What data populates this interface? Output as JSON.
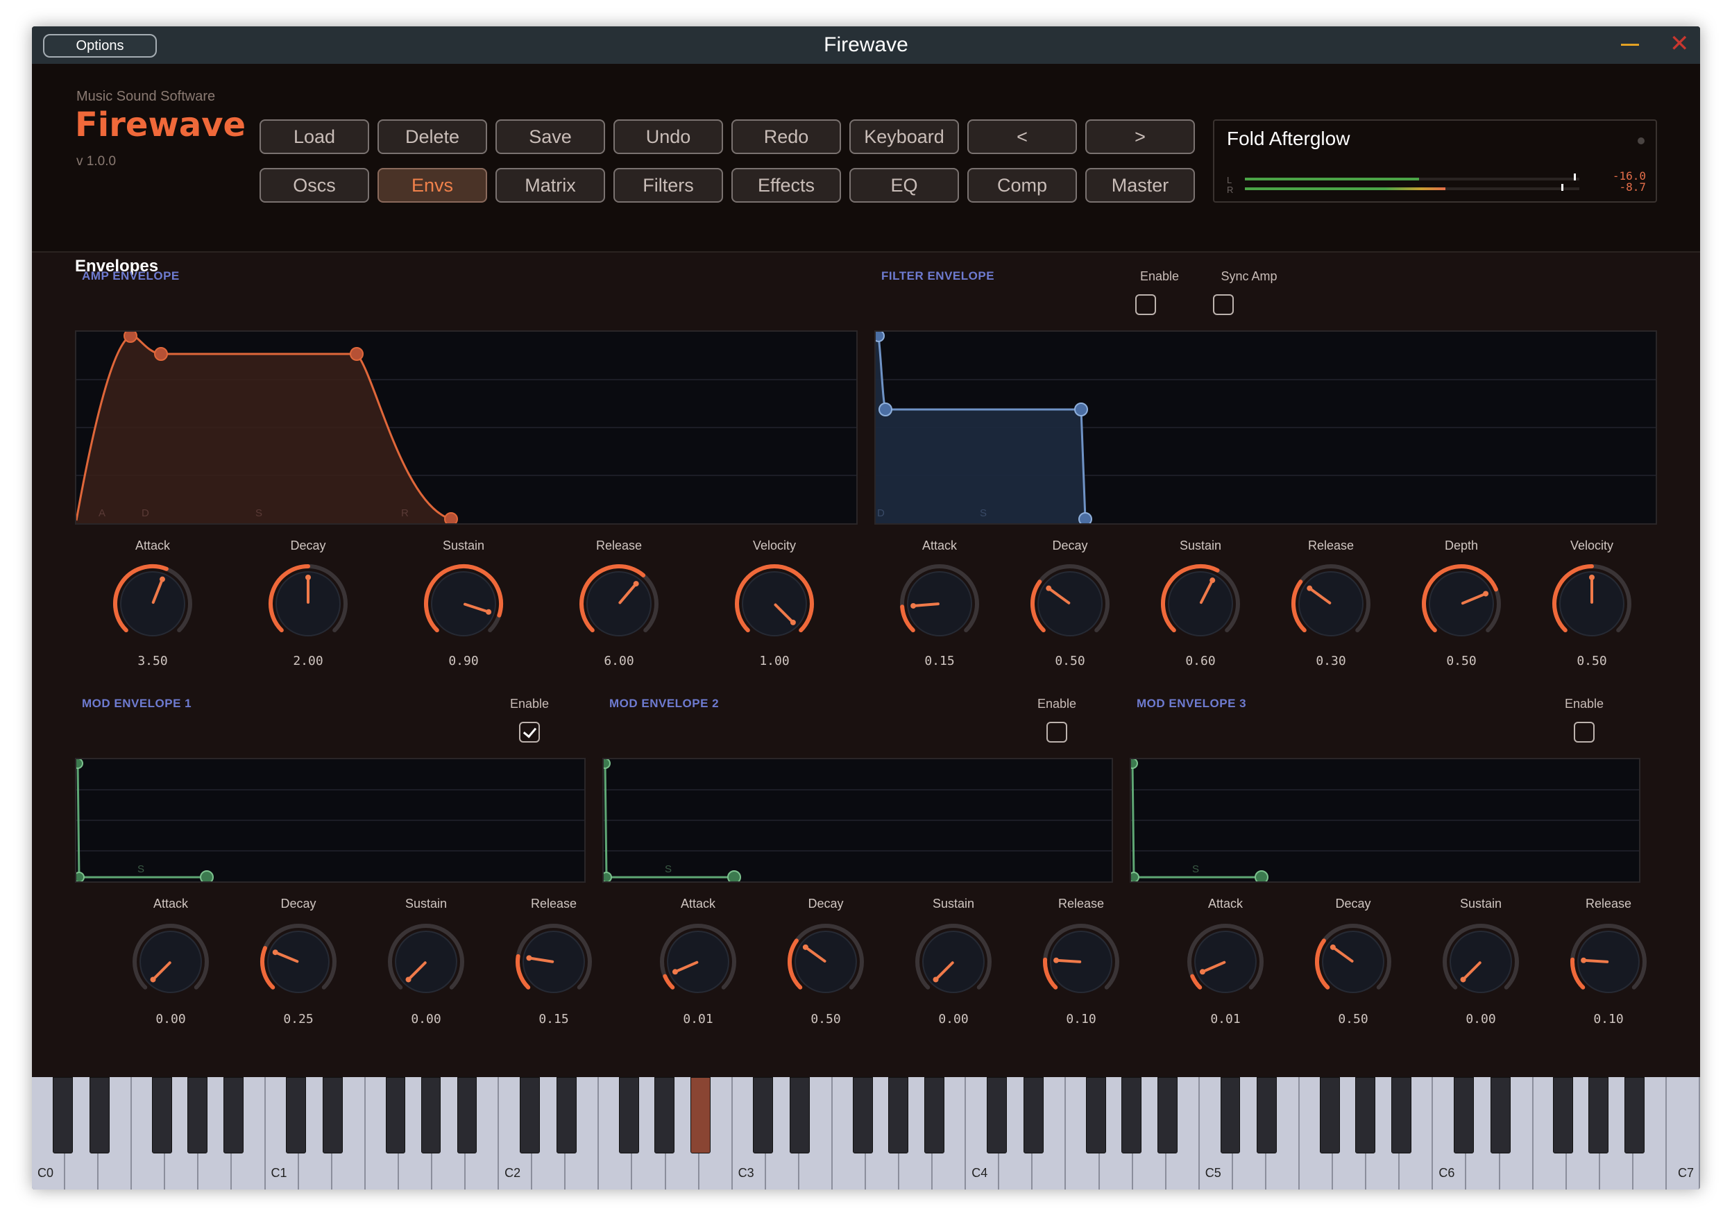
{
  "window": {
    "title": "Firewave",
    "options_label": "Options"
  },
  "brand": {
    "company": "Music Sound Software",
    "name": "Firewave",
    "version": "v 1.0.0"
  },
  "toolbar": {
    "row1": [
      "Load",
      "Delete",
      "Save",
      "Undo",
      "Redo",
      "Keyboard",
      "<",
      ">"
    ],
    "row2": [
      "Oscs",
      "Envs",
      "Matrix",
      "Filters",
      "Effects",
      "EQ",
      "Comp",
      "Master"
    ],
    "active": "Envs"
  },
  "preset": {
    "name": "Fold Afterglow",
    "meter_left_label": "L",
    "meter_right_label": "R",
    "meter_left_db": "-16.0",
    "meter_right_db": "-8.7",
    "meter_left_level": 0.52,
    "meter_right_level": 0.6
  },
  "section": {
    "title": "Envelopes"
  },
  "amp_env": {
    "title": "AMP ENVELOPE",
    "stage_letters": [
      "A",
      "D",
      "S",
      "R"
    ],
    "knobs": [
      {
        "label": "Attack",
        "value": "3.50",
        "fraction": 0.58
      },
      {
        "label": "Decay",
        "value": "2.00",
        "fraction": 0.5
      },
      {
        "label": "Sustain",
        "value": "0.90",
        "fraction": 0.9
      },
      {
        "label": "Release",
        "value": "6.00",
        "fraction": 0.65
      },
      {
        "label": "Velocity",
        "value": "1.00",
        "fraction": 1.0
      }
    ]
  },
  "filter_env": {
    "title": "FILTER ENVELOPE",
    "enable_label": "Enable",
    "enable_checked": false,
    "sync_label": "Sync Amp",
    "sync_checked": false,
    "stage_letters": [
      "D",
      "S"
    ],
    "knobs": [
      {
        "label": "Attack",
        "value": "0.15",
        "fraction": 0.15
      },
      {
        "label": "Decay",
        "value": "0.50",
        "fraction": 0.3
      },
      {
        "label": "Sustain",
        "value": "0.60",
        "fraction": 0.6
      },
      {
        "label": "Release",
        "value": "0.30",
        "fraction": 0.3
      },
      {
        "label": "Depth",
        "value": "0.50",
        "fraction": 0.75
      },
      {
        "label": "Velocity",
        "value": "0.50",
        "fraction": 0.5
      }
    ]
  },
  "mod_envs": [
    {
      "title": "MOD ENVELOPE 1",
      "enable_label": "Enable",
      "enable_checked": true,
      "stage_letter": "S",
      "knobs": [
        {
          "label": "Attack",
          "value": "0.00",
          "fraction": 0.0
        },
        {
          "label": "Decay",
          "value": "0.25",
          "fraction": 0.25
        },
        {
          "label": "Sustain",
          "value": "0.00",
          "fraction": 0.0
        },
        {
          "label": "Release",
          "value": "0.15",
          "fraction": 0.2
        }
      ]
    },
    {
      "title": "MOD ENVELOPE 2",
      "enable_label": "Enable",
      "enable_checked": false,
      "stage_letter": "S",
      "knobs": [
        {
          "label": "Attack",
          "value": "0.01",
          "fraction": 0.08
        },
        {
          "label": "Decay",
          "value": "0.50",
          "fraction": 0.3
        },
        {
          "label": "Sustain",
          "value": "0.00",
          "fraction": 0.0
        },
        {
          "label": "Release",
          "value": "0.10",
          "fraction": 0.18
        }
      ]
    },
    {
      "title": "MOD ENVELOPE 3",
      "enable_label": "Enable",
      "enable_checked": false,
      "stage_letter": "S",
      "knobs": [
        {
          "label": "Attack",
          "value": "0.01",
          "fraction": 0.08
        },
        {
          "label": "Decay",
          "value": "0.50",
          "fraction": 0.3
        },
        {
          "label": "Sustain",
          "value": "0.00",
          "fraction": 0.0
        },
        {
          "label": "Release",
          "value": "0.10",
          "fraction": 0.18
        }
      ]
    }
  ],
  "keyboard": {
    "octave_labels": [
      "C0",
      "C1",
      "C2",
      "C3",
      "C4",
      "C5",
      "C6",
      "C7"
    ],
    "pressed_note": "A#2"
  },
  "colors": {
    "accent": "#f0693a",
    "amp_curve": "#e0673a",
    "filter_curve": "#6f93c6",
    "mod_curve": "#5fa774",
    "section_label": "#6e7bd0"
  }
}
